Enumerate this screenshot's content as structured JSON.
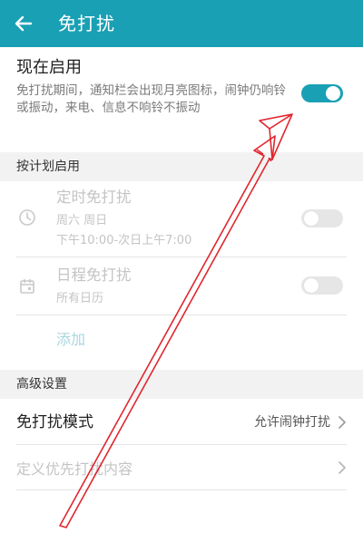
{
  "header": {
    "title": "免打扰",
    "back_icon": "back-arrow-icon"
  },
  "now_enable": {
    "title": "现在启用",
    "description": "免打扰期间，通知栏会出现月亮图标，闹钟仍响铃或振动，来电、信息不响铃不振动",
    "toggle_state": "on"
  },
  "scheduled": {
    "header": "按计划启用",
    "timer": {
      "title": "定时免打扰",
      "days": "周六 周日",
      "time_range": "下午10:00-次日上午7:00",
      "icon": "clock-icon",
      "toggle_state": "off"
    },
    "calendar": {
      "title": "日程免打扰",
      "subtitle": "所有日历",
      "icon": "calendar-icon",
      "toggle_state": "off"
    },
    "add_label": "添加"
  },
  "advanced": {
    "header": "高级设置",
    "mode": {
      "title": "免打扰模式",
      "value": "允许闹钟打扰"
    },
    "custom": {
      "title": "定义优先打扰内容"
    }
  },
  "colors": {
    "accent": "#1aa0b4",
    "annotation_arrow": "#e0262e"
  }
}
